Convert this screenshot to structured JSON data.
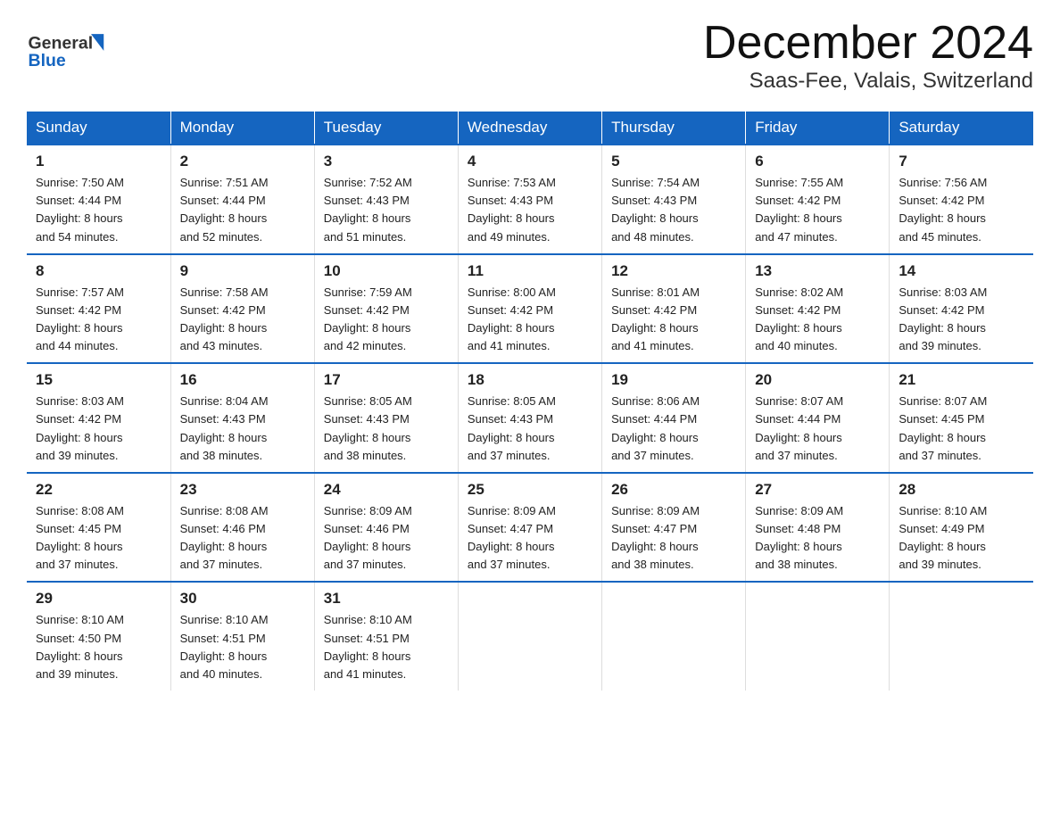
{
  "header": {
    "logo_general": "General",
    "logo_blue": "Blue",
    "month": "December 2024",
    "location": "Saas-Fee, Valais, Switzerland"
  },
  "weekdays": [
    "Sunday",
    "Monday",
    "Tuesday",
    "Wednesday",
    "Thursday",
    "Friday",
    "Saturday"
  ],
  "weeks": [
    [
      {
        "day": "1",
        "sunrise": "7:50 AM",
        "sunset": "4:44 PM",
        "daylight": "8 hours and 54 minutes."
      },
      {
        "day": "2",
        "sunrise": "7:51 AM",
        "sunset": "4:44 PM",
        "daylight": "8 hours and 52 minutes."
      },
      {
        "day": "3",
        "sunrise": "7:52 AM",
        "sunset": "4:43 PM",
        "daylight": "8 hours and 51 minutes."
      },
      {
        "day": "4",
        "sunrise": "7:53 AM",
        "sunset": "4:43 PM",
        "daylight": "8 hours and 49 minutes."
      },
      {
        "day": "5",
        "sunrise": "7:54 AM",
        "sunset": "4:43 PM",
        "daylight": "8 hours and 48 minutes."
      },
      {
        "day": "6",
        "sunrise": "7:55 AM",
        "sunset": "4:42 PM",
        "daylight": "8 hours and 47 minutes."
      },
      {
        "day": "7",
        "sunrise": "7:56 AM",
        "sunset": "4:42 PM",
        "daylight": "8 hours and 45 minutes."
      }
    ],
    [
      {
        "day": "8",
        "sunrise": "7:57 AM",
        "sunset": "4:42 PM",
        "daylight": "8 hours and 44 minutes."
      },
      {
        "day": "9",
        "sunrise": "7:58 AM",
        "sunset": "4:42 PM",
        "daylight": "8 hours and 43 minutes."
      },
      {
        "day": "10",
        "sunrise": "7:59 AM",
        "sunset": "4:42 PM",
        "daylight": "8 hours and 42 minutes."
      },
      {
        "day": "11",
        "sunrise": "8:00 AM",
        "sunset": "4:42 PM",
        "daylight": "8 hours and 41 minutes."
      },
      {
        "day": "12",
        "sunrise": "8:01 AM",
        "sunset": "4:42 PM",
        "daylight": "8 hours and 41 minutes."
      },
      {
        "day": "13",
        "sunrise": "8:02 AM",
        "sunset": "4:42 PM",
        "daylight": "8 hours and 40 minutes."
      },
      {
        "day": "14",
        "sunrise": "8:03 AM",
        "sunset": "4:42 PM",
        "daylight": "8 hours and 39 minutes."
      }
    ],
    [
      {
        "day": "15",
        "sunrise": "8:03 AM",
        "sunset": "4:42 PM",
        "daylight": "8 hours and 39 minutes."
      },
      {
        "day": "16",
        "sunrise": "8:04 AM",
        "sunset": "4:43 PM",
        "daylight": "8 hours and 38 minutes."
      },
      {
        "day": "17",
        "sunrise": "8:05 AM",
        "sunset": "4:43 PM",
        "daylight": "8 hours and 38 minutes."
      },
      {
        "day": "18",
        "sunrise": "8:05 AM",
        "sunset": "4:43 PM",
        "daylight": "8 hours and 37 minutes."
      },
      {
        "day": "19",
        "sunrise": "8:06 AM",
        "sunset": "4:44 PM",
        "daylight": "8 hours and 37 minutes."
      },
      {
        "day": "20",
        "sunrise": "8:07 AM",
        "sunset": "4:44 PM",
        "daylight": "8 hours and 37 minutes."
      },
      {
        "day": "21",
        "sunrise": "8:07 AM",
        "sunset": "4:45 PM",
        "daylight": "8 hours and 37 minutes."
      }
    ],
    [
      {
        "day": "22",
        "sunrise": "8:08 AM",
        "sunset": "4:45 PM",
        "daylight": "8 hours and 37 minutes."
      },
      {
        "day": "23",
        "sunrise": "8:08 AM",
        "sunset": "4:46 PM",
        "daylight": "8 hours and 37 minutes."
      },
      {
        "day": "24",
        "sunrise": "8:09 AM",
        "sunset": "4:46 PM",
        "daylight": "8 hours and 37 minutes."
      },
      {
        "day": "25",
        "sunrise": "8:09 AM",
        "sunset": "4:47 PM",
        "daylight": "8 hours and 37 minutes."
      },
      {
        "day": "26",
        "sunrise": "8:09 AM",
        "sunset": "4:47 PM",
        "daylight": "8 hours and 38 minutes."
      },
      {
        "day": "27",
        "sunrise": "8:09 AM",
        "sunset": "4:48 PM",
        "daylight": "8 hours and 38 minutes."
      },
      {
        "day": "28",
        "sunrise": "8:10 AM",
        "sunset": "4:49 PM",
        "daylight": "8 hours and 39 minutes."
      }
    ],
    [
      {
        "day": "29",
        "sunrise": "8:10 AM",
        "sunset": "4:50 PM",
        "daylight": "8 hours and 39 minutes."
      },
      {
        "day": "30",
        "sunrise": "8:10 AM",
        "sunset": "4:51 PM",
        "daylight": "8 hours and 40 minutes."
      },
      {
        "day": "31",
        "sunrise": "8:10 AM",
        "sunset": "4:51 PM",
        "daylight": "8 hours and 41 minutes."
      },
      null,
      null,
      null,
      null
    ]
  ],
  "labels": {
    "sunrise": "Sunrise: ",
    "sunset": "Sunset: ",
    "daylight": "Daylight: "
  }
}
